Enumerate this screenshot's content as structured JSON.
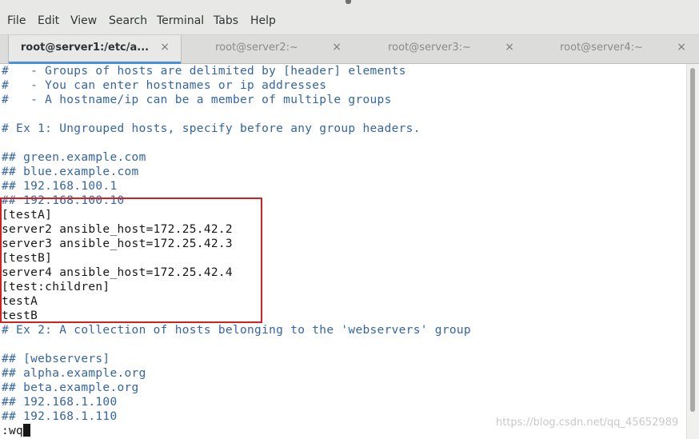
{
  "menu": [
    "File",
    "Edit",
    "View",
    "Search",
    "Terminal",
    "Tabs",
    "Help"
  ],
  "tabs": [
    {
      "label": "root@server1:/etc/a...",
      "active": true
    },
    {
      "label": "root@server2:~",
      "active": false
    },
    {
      "label": "root@server3:~",
      "active": false
    },
    {
      "label": "root@server4:~",
      "active": false
    }
  ],
  "close_glyph": "×",
  "terminal_lines": [
    "#   - Groups of hosts are delimited by [header] elements",
    "#   - You can enter hostnames or ip addresses",
    "#   - A hostname/ip can be a member of multiple groups",
    "",
    "# Ex 1: Ungrouped hosts, specify before any group headers.",
    "",
    "## green.example.com",
    "## blue.example.com",
    "## 192.168.100.1",
    "## 192.168.100.10",
    "[testA]",
    "server2 ansible_host=172.25.42.2",
    "server3 ansible_host=172.25.42.3",
    "[testB]",
    "server4 ansible_host=172.25.42.4",
    "[test:children]",
    "testA",
    "testB",
    "# Ex 2: A collection of hosts belonging to the 'webservers' group",
    "",
    "## [webservers]",
    "## alpha.example.org",
    "## beta.example.org",
    "## 192.168.1.100",
    "## 192.168.1.110",
    ":wq"
  ],
  "watermark": "https://blog.csdn.net/qq_45652989",
  "colors": {
    "comment": "#3465a4",
    "text": "#171717",
    "highlight": "#d42020",
    "tab_accent": "#4a90d9"
  }
}
